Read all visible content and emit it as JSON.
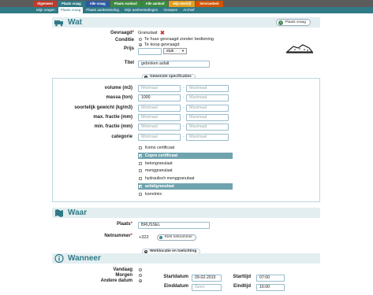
{
  "top_tabs": [
    {
      "label": "Algemeen",
      "color": "#c0392b"
    },
    {
      "label": "Plaats vraag",
      "color": "#2f7a86"
    },
    {
      "label": "Alle vraag",
      "color": "#2c5aa0"
    },
    {
      "label": "Plaats Aanbod",
      "color": "#3a8a3f"
    },
    {
      "label": "Alle aanbod",
      "color": "#3a8a3f"
    },
    {
      "label": "Mijn Bedrijf",
      "color": "#e0a020"
    },
    {
      "label": "Servicedesk",
      "color": "#d35400"
    }
  ],
  "sub_tabs": [
    "Mijn vragen",
    "Plaats vraag",
    "Plaats aanbesteding",
    "Mijn aanbestedingen",
    "Groepen",
    "Archief"
  ],
  "sub_active": "Plaats vraag",
  "wat": {
    "title": "Wat",
    "place_button": "Plaats vraag",
    "gevraagd_label": "Gevraagd",
    "gevraagd_value": "Granulaat",
    "conditie_label": "Conditie",
    "conditie_options": [
      "Te huur gevraagd zonder bediening",
      "Te koop gevraagd"
    ],
    "prijs_label": "Prijs",
    "prijs_unit": "stuk",
    "titel_label": "Titel",
    "titel_value": "gebroken asfalt"
  },
  "specs": {
    "toggle_label": "Gewenste specificaties",
    "rows": [
      {
        "label": "volume (m3)",
        "min": "Minimaal",
        "max": "Maximaal",
        "min_filled": false
      },
      {
        "label": "massa (ton)",
        "min": "1000",
        "max": "Maximaal",
        "min_filled": true
      },
      {
        "label": "soortelijk gewicht (kg/m3)",
        "min": "Minimaal",
        "max": "Maximaal",
        "min_filled": false
      },
      {
        "label": "max. fractie (mm)",
        "min": "Minimaal",
        "max": "Maximaal",
        "min_filled": false
      },
      {
        "label": "min. fractie (mm)",
        "min": "Minimaal",
        "max": "Maximaal",
        "min_filled": false
      },
      {
        "label": "categorie",
        "min": "Minimaal",
        "max": "Maximaal",
        "min_filled": false
      }
    ],
    "checkboxes": [
      {
        "label": "Komo certificaat",
        "checked": false
      },
      {
        "label": "Copro certificaat",
        "checked": true
      },
      {
        "label": "betongranulaat",
        "checked": false
      },
      {
        "label": "menggranulaat",
        "checked": false
      },
      {
        "label": "hydraulisch menggranulaat",
        "checked": false
      },
      {
        "label": "asfaltgranulaat",
        "checked": true
      },
      {
        "label": "korrelmix",
        "checked": false
      }
    ]
  },
  "waar": {
    "title": "Waar",
    "plaats_label": "Plaats",
    "plaats_value": "BRUSSEL",
    "netnummer_label": "Netnummer",
    "netnummer_value": "+322",
    "kies_button": "Kies netnummer",
    "toggle_label": "Werklocatie en toelichting"
  },
  "wanneer": {
    "title": "Wanneer",
    "options": [
      "Vandaag",
      "Morgen",
      "Andere datum"
    ],
    "startdatum_label": "Startdatum",
    "startdatum_value": "09-02-2015",
    "starttijd_label": "Starttijd",
    "starttijd_value": "07:00",
    "einddatum_label": "Einddatum",
    "einddatum_value": "Geen",
    "eindtijd_label": "Eindtijd",
    "eindtijd_value": "16:00"
  }
}
